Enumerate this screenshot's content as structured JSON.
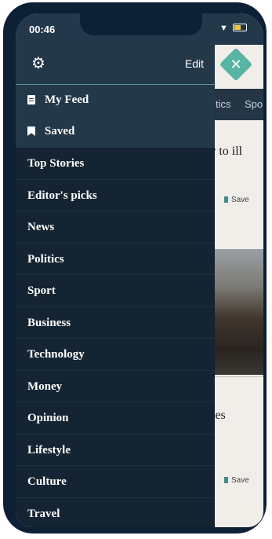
{
  "status_bar": {
    "time": "00:46"
  },
  "background": {
    "tabs": [
      "tics",
      "Spo"
    ],
    "article1_title": "r to ill",
    "article2_title": "ies",
    "save_label": "Save"
  },
  "drawer": {
    "edit_label": "Edit",
    "pinned": [
      {
        "label": "My Feed",
        "icon": "document-icon"
      },
      {
        "label": "Saved",
        "icon": "bookmark-icon"
      }
    ],
    "sections": [
      "Top Stories",
      "Editor's picks",
      "News",
      "Politics",
      "Sport",
      "Business",
      "Technology",
      "Money",
      "Opinion",
      "Lifestyle",
      "Culture",
      "Travel"
    ]
  },
  "colors": {
    "device": "#0d2036",
    "drawer_bg": "#152432",
    "drawer_header": "#233849",
    "accent": "#58b4a3"
  }
}
